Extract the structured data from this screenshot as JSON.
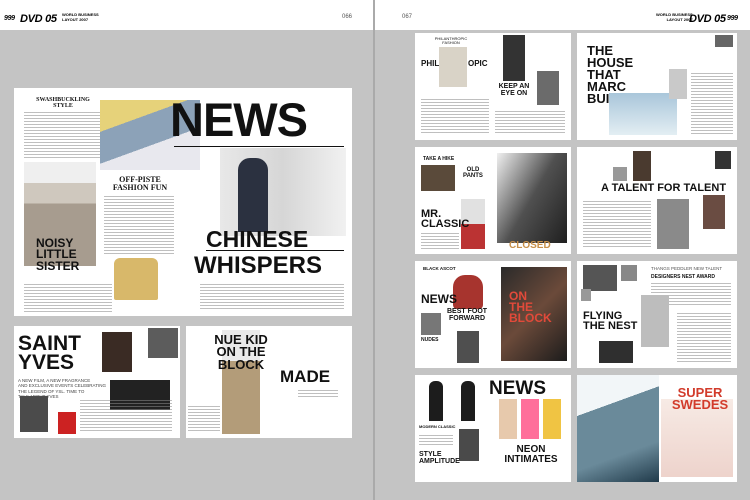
{
  "header": {
    "left_logo_num": "999",
    "left_logo": "DVD 05",
    "left_logo_sub": "WORLD BUSINESS\nLAYOUT 2007",
    "left_page": "066",
    "right_page": "067",
    "right_logo_sub": "WORLD BUSINESS\nLAYOUT 2007",
    "right_logo": "DVD 05",
    "right_logo_num": "999"
  },
  "left": {
    "news_page": {
      "kicker": "SWASHBUCKLING\nSTYLE",
      "headline": "NEWS",
      "offpiste": "OFF-PISTE\nFASHION FUN",
      "noisy": "NOISY\nLITTLE\nSISTER",
      "chinese": "CHINESE",
      "whispers": "WHISPERS"
    },
    "saint_page": {
      "headline": "SAINT\nYVES",
      "dek": "A NEW FILM, A NEW FRAGRANCE\nAND EXCLUSIVE EVENTS CELEBRATING\nTHE LEGEND OF YSL. TIME TO\nTALK ABOUT YVES"
    },
    "nuekid_page": {
      "headline": "NUE KID\nON THE\nBLOCK",
      "made": "MADE"
    }
  },
  "right": {
    "p1": {
      "kicker": "PHILANTHROPIC\nFASHION",
      "phil": "PHIL",
      "opic": "OPIC",
      "keep": "KEEP AN\nEYE ON"
    },
    "p2": {
      "headline": "THE\nHOUSE\nTHAT\nMARC\nBUILT"
    },
    "p3": {
      "take": "TAKE A HIKE",
      "oldpants": "OLD\nPANTS",
      "mr": "MR.\nCLASSIC",
      "closed": "CLOSED"
    },
    "p4": {
      "headline": "A TALENT FOR TALENT"
    },
    "p5": {
      "kicker": "BLACK ASCOT",
      "news": "NEWS",
      "bestfoot": "BEST FOOT\nFORWARD",
      "nudes": "NUDES",
      "onthe": "ON\nTHE\nBLOCK"
    },
    "p6": {
      "award": "THANGS PEDDLER NEW TALENT",
      "award2": "DESIGNERS NEST AWARD",
      "flying": "FLYING\nTHE NEST"
    },
    "p7": {
      "news": "NEWS",
      "modern": "MODERN CLASSIC",
      "style": "STYLE\nAMPLITUDE",
      "neon": "NEON\nINTIMATES"
    },
    "p8": {
      "headline": "SUPER\nSWEDES"
    }
  },
  "colors": {
    "spread_bg": "#c4c4c4",
    "accent_red": "#d23b2b",
    "ink": "#111111",
    "tan": "#d8b86a"
  }
}
